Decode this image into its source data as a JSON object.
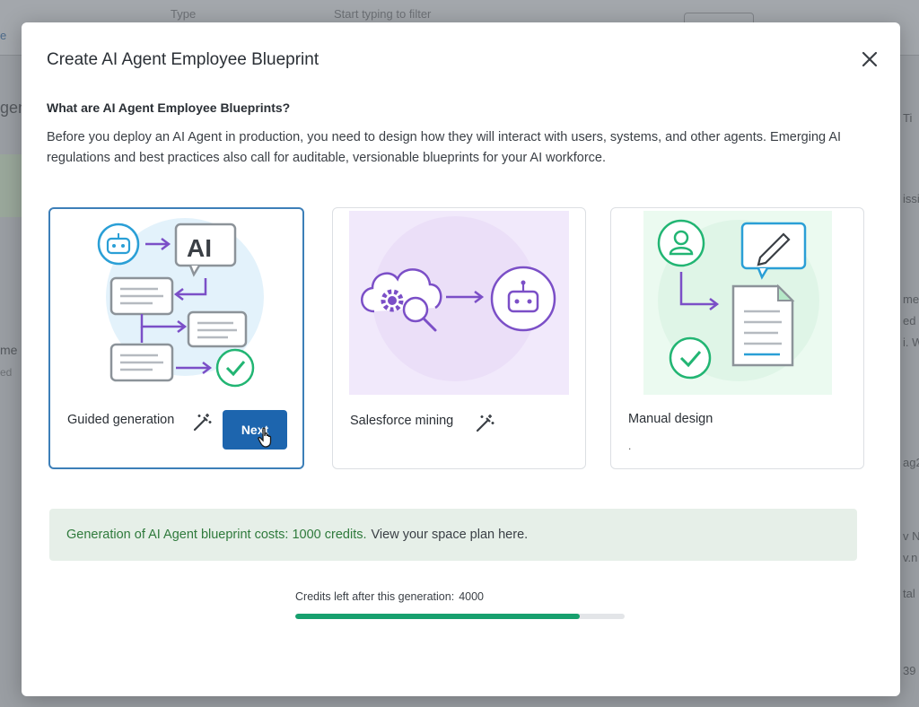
{
  "background": {
    "type_label": "Type",
    "filter_placeholder": "Start typing to filter",
    "tab_fragment": "e",
    "heading_fragment": "gen",
    "item_fragment": "me",
    "sub_fragment": "ed",
    "right_fragments": [
      "Ti",
      "issi",
      "me",
      "ed i",
      "i. W",
      "ag2",
      "v N",
      "v.n",
      "tal",
      "39"
    ]
  },
  "modal": {
    "title": "Create AI Agent Employee Blueprint",
    "close_icon": "close-icon",
    "section_heading": "What are AI Agent Employee Blueprints?",
    "description": "Before you deploy an AI Agent in production, you need to design how they will interact with users, systems, and other agents. Emerging AI regulations and best practices also call for auditable, versionable blueprints for your AI workforce.",
    "cards": [
      {
        "label": "Guided generation",
        "icon": "magic-wand-icon",
        "selected": true,
        "action_label": "Next"
      },
      {
        "label": "Salesforce mining",
        "icon": "magic-wand-icon",
        "selected": false
      },
      {
        "label": "Manual design",
        "icon": "",
        "selected": false,
        "sub": "."
      }
    ],
    "banner": {
      "cost_text": "Generation of AI Agent blueprint costs: 1000 credits.",
      "link_text": "View your space plan here."
    },
    "credits": {
      "label": "Credits left after this generation:",
      "value": "4000",
      "fraction_used": 0.865
    }
  },
  "colors": {
    "primary_button": "#1d65ae",
    "selected_border": "#3d7fb8",
    "banner_bg": "#e6efe8",
    "banner_text": "#2f7a3c",
    "progress": "#17a06e",
    "accent_purple": "#7b4fc7",
    "accent_blue": "#2a9fd6",
    "accent_green": "#22b573"
  }
}
